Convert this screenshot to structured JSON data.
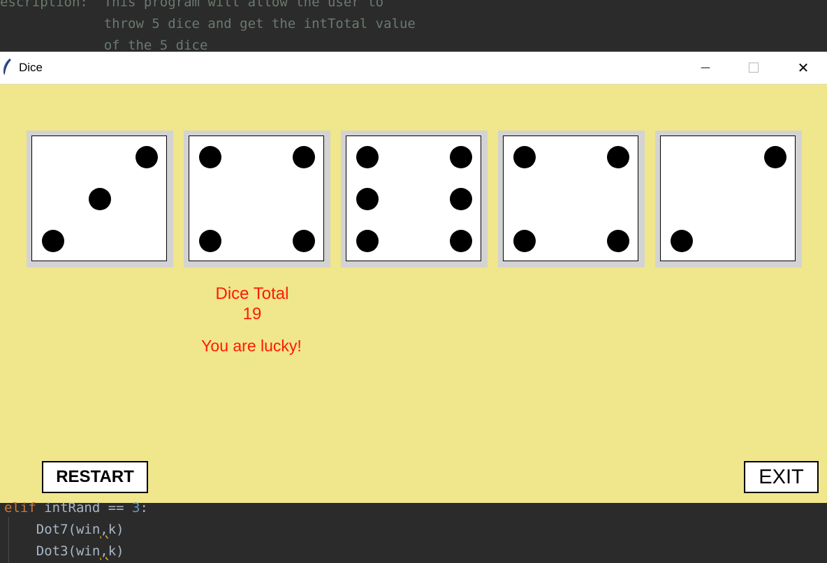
{
  "code_top": {
    "line1": "escription:  This program will allow the user to",
    "line2": "             throw 5 dice and get the intTotal value",
    "line3": "             of the 5 dice"
  },
  "code_bottom": {
    "line1_kw": "elif",
    "line1_mid": " intRand == ",
    "line1_num": "3",
    "line1_end": ":",
    "line2_pre": "    Dot7(win",
    "line2_post": "k)",
    "line3_pre": "    Dot3(win",
    "line3_post": "k)",
    "comma": ","
  },
  "window": {
    "title": "Dice",
    "min_glyph": "—",
    "max_glyph": "☐",
    "close_glyph": "✕"
  },
  "dice": [
    {
      "value": 3
    },
    {
      "value": 4
    },
    {
      "value": 6
    },
    {
      "value": 4
    },
    {
      "value": 2
    }
  ],
  "result": {
    "total_label": "Dice Total",
    "total_value": "19",
    "message": "You are lucky!"
  },
  "buttons": {
    "restart": "RESTART",
    "exit": "EXIT"
  },
  "colors": {
    "window_bg": "#f0e68c",
    "text_accent": "#ff1a00",
    "die_frame": "#d3d3d3"
  }
}
